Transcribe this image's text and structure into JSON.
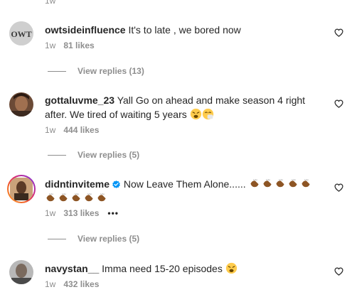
{
  "top_fragment": "1w",
  "comments": [
    {
      "username": "owtsideinfluence",
      "text": "It's to late , we bored now",
      "time": "1w",
      "likes": "81 likes",
      "replies": "View replies (13)",
      "avatar_label": "OWT"
    },
    {
      "username": "gottaluvme_23",
      "text": "Yall Go on ahead and make season 4 right after. We tired of waiting 5 years",
      "time": "1w",
      "likes": "444 likes",
      "replies": "View replies (5)"
    },
    {
      "username": "didntinviteme",
      "text": "Now Leave Them Alone......",
      "time": "1w",
      "likes": "313 likes",
      "more": "•••",
      "replies": "View replies (5)",
      "verified": true
    },
    {
      "username": "navystan__",
      "text": "Imma need 15-20 episodes",
      "time": "1w",
      "likes": "432 likes"
    }
  ],
  "colors": {
    "text": "#262626",
    "secondary": "#8e8e8e",
    "verified": "#0095f6",
    "clap": "#8d5524"
  }
}
